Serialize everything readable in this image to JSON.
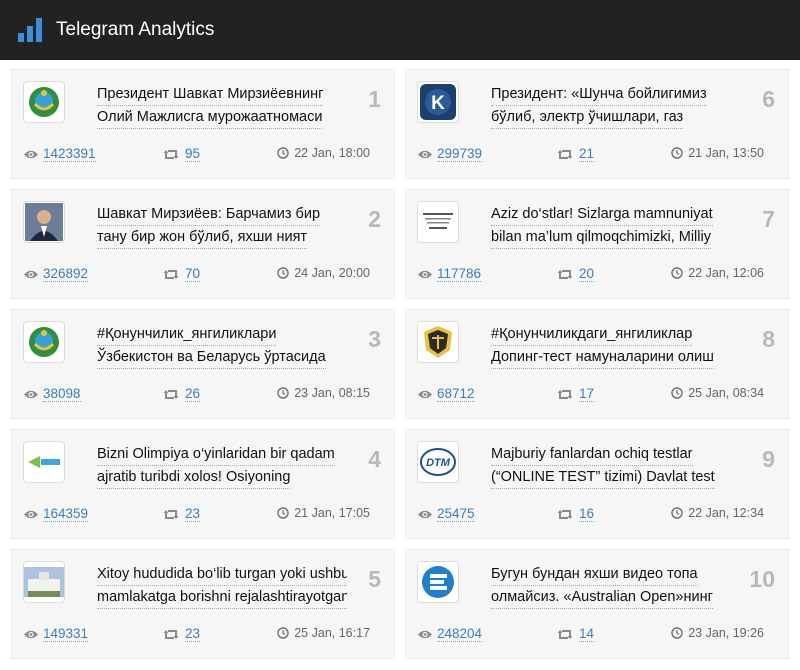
{
  "header": {
    "title": "Telegram Analytics"
  },
  "posts": [
    {
      "rank": "1",
      "line1": "Президент Шавкат Мирзиёевнинг",
      "line2": "Олий Мажлисга мурожаатномаси",
      "views": "1423391",
      "shares": "95",
      "date": "22 Jan, 18:00",
      "thumb": "state-emblem"
    },
    {
      "rank": "2",
      "line1": "Шавкат Мирзиёев: Барчамиз бир",
      "line2": "тану бир жон бўлиб, яхши ният",
      "views": "326892",
      "shares": "70",
      "date": "24 Jan, 20:00",
      "thumb": "portrait"
    },
    {
      "rank": "3",
      "line1": "#Қонунчилик_янгиликлари",
      "line2": "Ўзбекистон ва Беларусь ўртасида",
      "views": "38098",
      "shares": "26",
      "date": "23 Jan, 08:15",
      "thumb": "state-emblem"
    },
    {
      "rank": "4",
      "line1": "Bizni Olimpiya o‘yinlaridan bir qadam",
      "line2": "ajratib turibdi xolos! Osiyoning",
      "views": "164359",
      "shares": "23",
      "date": "21 Jan, 17:05",
      "thumb": "green-logo"
    },
    {
      "rank": "5",
      "line1": "Xitoy hududida bo‘lib turgan yoki ushbu",
      "line2": "mamlakatga borishni rejalashtirayotgan",
      "views": "149331",
      "shares": "23",
      "date": "25 Jan, 16:17",
      "thumb": "building"
    },
    {
      "rank": "6",
      "line1": "Президент: «Шунча бойлигимиз",
      "line2": "бўлиб, электр ўчишлари, газ",
      "views": "299739",
      "shares": "21",
      "date": "21 Jan, 13:50",
      "thumb": "k-logo"
    },
    {
      "rank": "7",
      "line1": "Aziz do‘stlar! Sizlarga mamnuniyat",
      "line2": "bilan ma’lum qilmoqchimizki, Milliy",
      "views": "117786",
      "shares": "20",
      "date": "22 Jan, 12:06",
      "thumb": "doc-logo"
    },
    {
      "rank": "8",
      "line1": "#Қонунчиликдаги_янгиликлар",
      "line2": "Допинг-тест намуналарини олиш",
      "views": "68712",
      "shares": "17",
      "date": "25 Jan, 08:34",
      "thumb": "justice-emblem"
    },
    {
      "rank": "9",
      "line1": "Majburiy fanlardan ochiq testlar",
      "line2": "(“ONLINE TEST” tizimi) Davlat test",
      "views": "25475",
      "shares": "16",
      "date": "22 Jan, 12:34",
      "thumb": "dtm-logo",
      "thumb_text": "DTM"
    },
    {
      "rank": "10",
      "line1": "Бугун бундан яхши видео топа",
      "line2": "олмайсиз. «Australian Open»нинг",
      "views": "248204",
      "shares": "14",
      "date": "23 Jan, 19:26",
      "thumb": "blue-e-logo"
    }
  ],
  "colors": {
    "topbar": "#222222",
    "accent": "#3a8fd8",
    "link": "#3a7fc0",
    "rank": "#b8b8b8"
  }
}
